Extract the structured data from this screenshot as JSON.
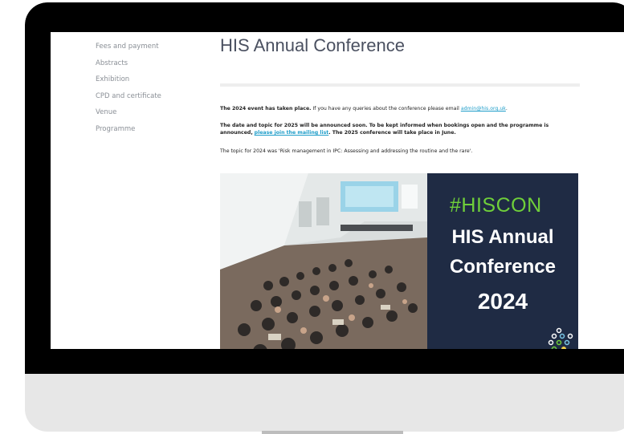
{
  "sidebar": {
    "items": [
      {
        "label": "Fees and payment"
      },
      {
        "label": "Abstracts"
      },
      {
        "label": "Exhibition"
      },
      {
        "label": "CPD and certificate"
      },
      {
        "label": "Venue"
      },
      {
        "label": "Programme"
      }
    ]
  },
  "main": {
    "title": "HIS Annual Conference",
    "para1": {
      "bold": "The 2024 event has taken place.",
      "text": " If you have any queries about the conference please email ",
      "email": "admin@his.org.uk",
      "end": "."
    },
    "para2": {
      "bold": "The date and topic for 2025 will be announced soon. To be kept informed when bookings open and the programme is announced,",
      "link": "please join the mailing list",
      "bold2": ". The 2025 conference will take place in June."
    },
    "para3": "The topic for 2024 was 'Risk management in IPC: Assessing and addressing the routine and the rare'.",
    "hero": {
      "hashtag": "#HISCON",
      "line1": "HIS Annual",
      "line2": "Conference",
      "line3": "2024"
    }
  },
  "colors": {
    "accent_link": "#1e9dc9",
    "hashtag_green": "#6fcf3a",
    "panel_navy": "#1f2b44"
  }
}
